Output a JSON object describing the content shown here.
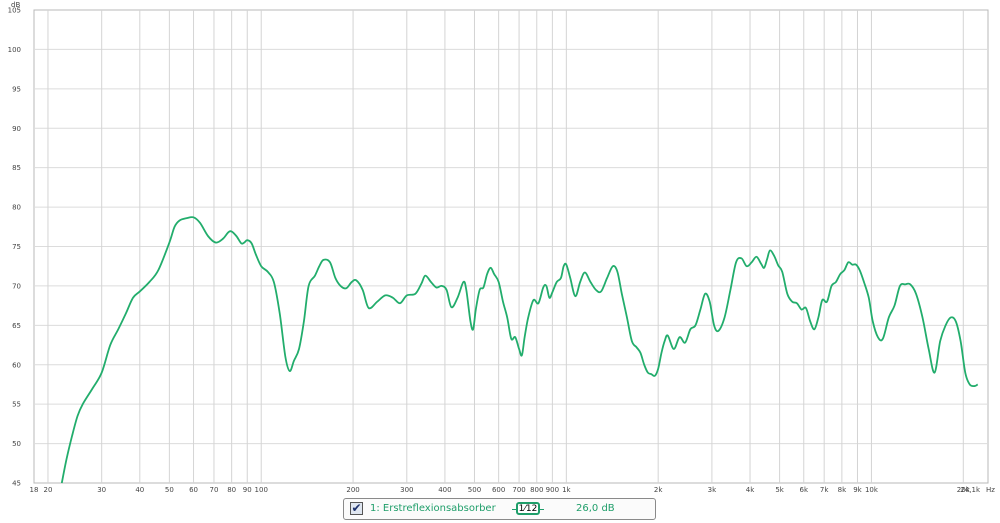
{
  "chart_data": {
    "type": "line",
    "x_scale": "log",
    "y_unit": "dB",
    "x_unit": "Hz",
    "xlim": [
      18,
      24100
    ],
    "ylim": [
      45,
      105
    ],
    "grid": true,
    "y_ticks": [
      45,
      50,
      55,
      60,
      65,
      70,
      75,
      80,
      85,
      90,
      95,
      100,
      105
    ],
    "x_ticks": [
      {
        "v": 18,
        "label": "18"
      },
      {
        "v": 20,
        "label": "20"
      },
      {
        "v": 30,
        "label": "30"
      },
      {
        "v": 40,
        "label": "40"
      },
      {
        "v": 50,
        "label": "50"
      },
      {
        "v": 60,
        "label": "60"
      },
      {
        "v": 70,
        "label": "70"
      },
      {
        "v": 80,
        "label": "80"
      },
      {
        "v": 90,
        "label": "90"
      },
      {
        "v": 100,
        "label": "100"
      },
      {
        "v": 200,
        "label": "200"
      },
      {
        "v": 300,
        "label": "300"
      },
      {
        "v": 400,
        "label": "400"
      },
      {
        "v": 500,
        "label": "500"
      },
      {
        "v": 600,
        "label": "600"
      },
      {
        "v": 700,
        "label": "700"
      },
      {
        "v": 800,
        "label": "800"
      },
      {
        "v": 900,
        "label": "900"
      },
      {
        "v": 1000,
        "label": "1k"
      },
      {
        "v": 2000,
        "label": "2k"
      },
      {
        "v": 3000,
        "label": "3k"
      },
      {
        "v": 4000,
        "label": "4k"
      },
      {
        "v": 5000,
        "label": "5k"
      },
      {
        "v": 6000,
        "label": "6k"
      },
      {
        "v": 7000,
        "label": "7k"
      },
      {
        "v": 8000,
        "label": "8k"
      },
      {
        "v": 9000,
        "label": "9k"
      },
      {
        "v": 10000,
        "label": "10k"
      },
      {
        "v": 20000,
        "label": "20k"
      },
      {
        "v": 24100,
        "label": "24,1k"
      }
    ],
    "series": [
      {
        "color": "#22ad6c",
        "points": [
          [
            22.2,
            45
          ],
          [
            23,
            48
          ],
          [
            24,
            51
          ],
          [
            25,
            53.5
          ],
          [
            26,
            55
          ],
          [
            28,
            57
          ],
          [
            30,
            59
          ],
          [
            32,
            62.5
          ],
          [
            34,
            64.5
          ],
          [
            36,
            66.5
          ],
          [
            38,
            68.5
          ],
          [
            40,
            69.3
          ],
          [
            43,
            70.5
          ],
          [
            46,
            72
          ],
          [
            50,
            75.5
          ],
          [
            52,
            77.5
          ],
          [
            54,
            78.3
          ],
          [
            57,
            78.6
          ],
          [
            60,
            78.7
          ],
          [
            63,
            78
          ],
          [
            67,
            76.3
          ],
          [
            71,
            75.5
          ],
          [
            75,
            76
          ],
          [
            78,
            76.8
          ],
          [
            80,
            76.9
          ],
          [
            83,
            76.3
          ],
          [
            86,
            75.4
          ],
          [
            88,
            75.5
          ],
          [
            90,
            75.8
          ],
          [
            93,
            75.4
          ],
          [
            96,
            74
          ],
          [
            100,
            72.5
          ],
          [
            105,
            71.8
          ],
          [
            110,
            70.5
          ],
          [
            115,
            66.5
          ],
          [
            120,
            61
          ],
          [
            124,
            59.2
          ],
          [
            128,
            60.5
          ],
          [
            133,
            62
          ],
          [
            138,
            65.5
          ],
          [
            143,
            70
          ],
          [
            150,
            71.3
          ],
          [
            155,
            72.5
          ],
          [
            160,
            73.3
          ],
          [
            168,
            73
          ],
          [
            175,
            71
          ],
          [
            182,
            70
          ],
          [
            190,
            69.7
          ],
          [
            198,
            70.5
          ],
          [
            205,
            70.7
          ],
          [
            215,
            69.5
          ],
          [
            225,
            67.2
          ],
          [
            240,
            68
          ],
          [
            255,
            68.8
          ],
          [
            270,
            68.5
          ],
          [
            285,
            67.8
          ],
          [
            300,
            68.8
          ],
          [
            320,
            69
          ],
          [
            335,
            70.3
          ],
          [
            345,
            71.3
          ],
          [
            360,
            70.5
          ],
          [
            375,
            69.8
          ],
          [
            390,
            70
          ],
          [
            405,
            69.5
          ],
          [
            420,
            67.3
          ],
          [
            440,
            68.5
          ],
          [
            460,
            70.5
          ],
          [
            470,
            69.5
          ],
          [
            485,
            65.5
          ],
          [
            495,
            64.5
          ],
          [
            505,
            67
          ],
          [
            520,
            69.5
          ],
          [
            535,
            69.8
          ],
          [
            550,
            71.5
          ],
          [
            565,
            72.3
          ],
          [
            580,
            71.5
          ],
          [
            600,
            70.5
          ],
          [
            620,
            68
          ],
          [
            640,
            66
          ],
          [
            660,
            63.3
          ],
          [
            680,
            63.5
          ],
          [
            700,
            62
          ],
          [
            715,
            61.2
          ],
          [
            730,
            63.5
          ],
          [
            750,
            66
          ],
          [
            780,
            68.2
          ],
          [
            810,
            67.8
          ],
          [
            840,
            69.8
          ],
          [
            860,
            70
          ],
          [
            880,
            68.5
          ],
          [
            900,
            69.2
          ],
          [
            930,
            70.5
          ],
          [
            960,
            71
          ],
          [
            980,
            72.5
          ],
          [
            1000,
            72.7
          ],
          [
            1030,
            71
          ],
          [
            1070,
            68.7
          ],
          [
            1110,
            70.5
          ],
          [
            1150,
            71.7
          ],
          [
            1200,
            70.5
          ],
          [
            1250,
            69.5
          ],
          [
            1300,
            69.3
          ],
          [
            1360,
            71
          ],
          [
            1420,
            72.5
          ],
          [
            1470,
            71.8
          ],
          [
            1520,
            69
          ],
          [
            1580,
            66
          ],
          [
            1640,
            63
          ],
          [
            1700,
            62.2
          ],
          [
            1750,
            61.5
          ],
          [
            1800,
            60
          ],
          [
            1850,
            59
          ],
          [
            1900,
            58.8
          ],
          [
            1950,
            58.6
          ],
          [
            2000,
            59.5
          ],
          [
            2050,
            61.5
          ],
          [
            2100,
            63
          ],
          [
            2150,
            63.7
          ],
          [
            2250,
            62
          ],
          [
            2350,
            63.5
          ],
          [
            2450,
            62.8
          ],
          [
            2550,
            64.5
          ],
          [
            2650,
            65
          ],
          [
            2750,
            67
          ],
          [
            2850,
            69
          ],
          [
            2950,
            68
          ],
          [
            3050,
            65
          ],
          [
            3150,
            64.3
          ],
          [
            3300,
            66
          ],
          [
            3450,
            69.5
          ],
          [
            3600,
            73
          ],
          [
            3750,
            73.5
          ],
          [
            3900,
            72.5
          ],
          [
            4050,
            73
          ],
          [
            4200,
            73.7
          ],
          [
            4350,
            72.8
          ],
          [
            4450,
            72.3
          ],
          [
            4550,
            73.4
          ],
          [
            4650,
            74.5
          ],
          [
            4800,
            73.8
          ],
          [
            4950,
            72.6
          ],
          [
            5100,
            71.8
          ],
          [
            5300,
            69
          ],
          [
            5500,
            68
          ],
          [
            5700,
            67.8
          ],
          [
            5900,
            67
          ],
          [
            6100,
            67.2
          ],
          [
            6300,
            65.5
          ],
          [
            6500,
            64.5
          ],
          [
            6700,
            66
          ],
          [
            6900,
            68.2
          ],
          [
            7150,
            68
          ],
          [
            7400,
            70
          ],
          [
            7650,
            70.5
          ],
          [
            7900,
            71.5
          ],
          [
            8150,
            72
          ],
          [
            8400,
            73
          ],
          [
            8650,
            72.7
          ],
          [
            8900,
            72.7
          ],
          [
            9150,
            72
          ],
          [
            9450,
            70.5
          ],
          [
            9800,
            68.5
          ],
          [
            10100,
            65.5
          ],
          [
            10500,
            63.5
          ],
          [
            10900,
            63.3
          ],
          [
            11400,
            66
          ],
          [
            11900,
            67.5
          ],
          [
            12400,
            70
          ],
          [
            12900,
            70.2
          ],
          [
            13400,
            70.2
          ],
          [
            14000,
            69
          ],
          [
            14700,
            66
          ],
          [
            15400,
            62
          ],
          [
            16100,
            59
          ],
          [
            16800,
            63
          ],
          [
            17500,
            65
          ],
          [
            18200,
            66
          ],
          [
            18900,
            65.5
          ],
          [
            19600,
            63
          ],
          [
            20300,
            59
          ],
          [
            21000,
            57.5
          ],
          [
            21800,
            57.3
          ],
          [
            22300,
            57.5
          ]
        ]
      }
    ]
  },
  "legend": {
    "checked": true,
    "check_glyph": "✔",
    "series_label": "1: Erstreflexionsabsorber",
    "smoothing": "1⁄12",
    "offset": "26,0 dB"
  }
}
